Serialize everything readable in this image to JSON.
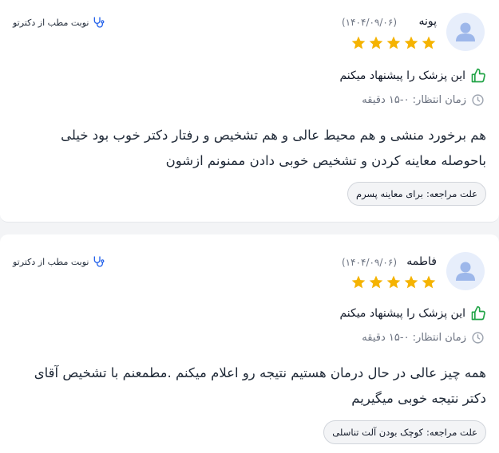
{
  "colors": {
    "star": "#f5b301",
    "thumb": "#22a447",
    "link_icon": "#2563eb",
    "avatar_bg": "#e7eefb",
    "avatar_fg": "#9db7ea"
  },
  "reviews": [
    {
      "name": "پونه",
      "date": "(۱۴۰۴/۰۹/۰۶)",
      "rating": 5,
      "book_link": "نوبت مطب از دکترتو",
      "recommend": "این پزشک را پیشنهاد میکنم",
      "wait_time": "زمان انتظار: ۰-۱۵ دقیقه",
      "comment": "هم برخورد منشی و هم محیط عالی و هم تشخیص و رفتار دکتر خوب بود خیلی باحوصله معاینه کردن و تشخیص خوبی دادن ممنونم ازشون",
      "reason_label": "علت مراجعه:",
      "reason_value": "برای معاینه پسرم"
    },
    {
      "name": "فاطمه",
      "date": "(۱۴۰۴/۰۹/۰۶)",
      "rating": 5,
      "book_link": "نوبت مطب از دکترتو",
      "recommend": "این پزشک را پیشنهاد میکنم",
      "wait_time": "زمان انتظار: ۰-۱۵ دقیقه",
      "comment": "همه چیز عالی در حال درمان هستیم نتیجه رو اعلام میکنم .مطمعنم با تشخیص آقای دکتر نتیجه خوبی میگیریم",
      "reason_label": "علت مراجعه:",
      "reason_value": "کوچک بودن آلت تناسلی"
    }
  ]
}
